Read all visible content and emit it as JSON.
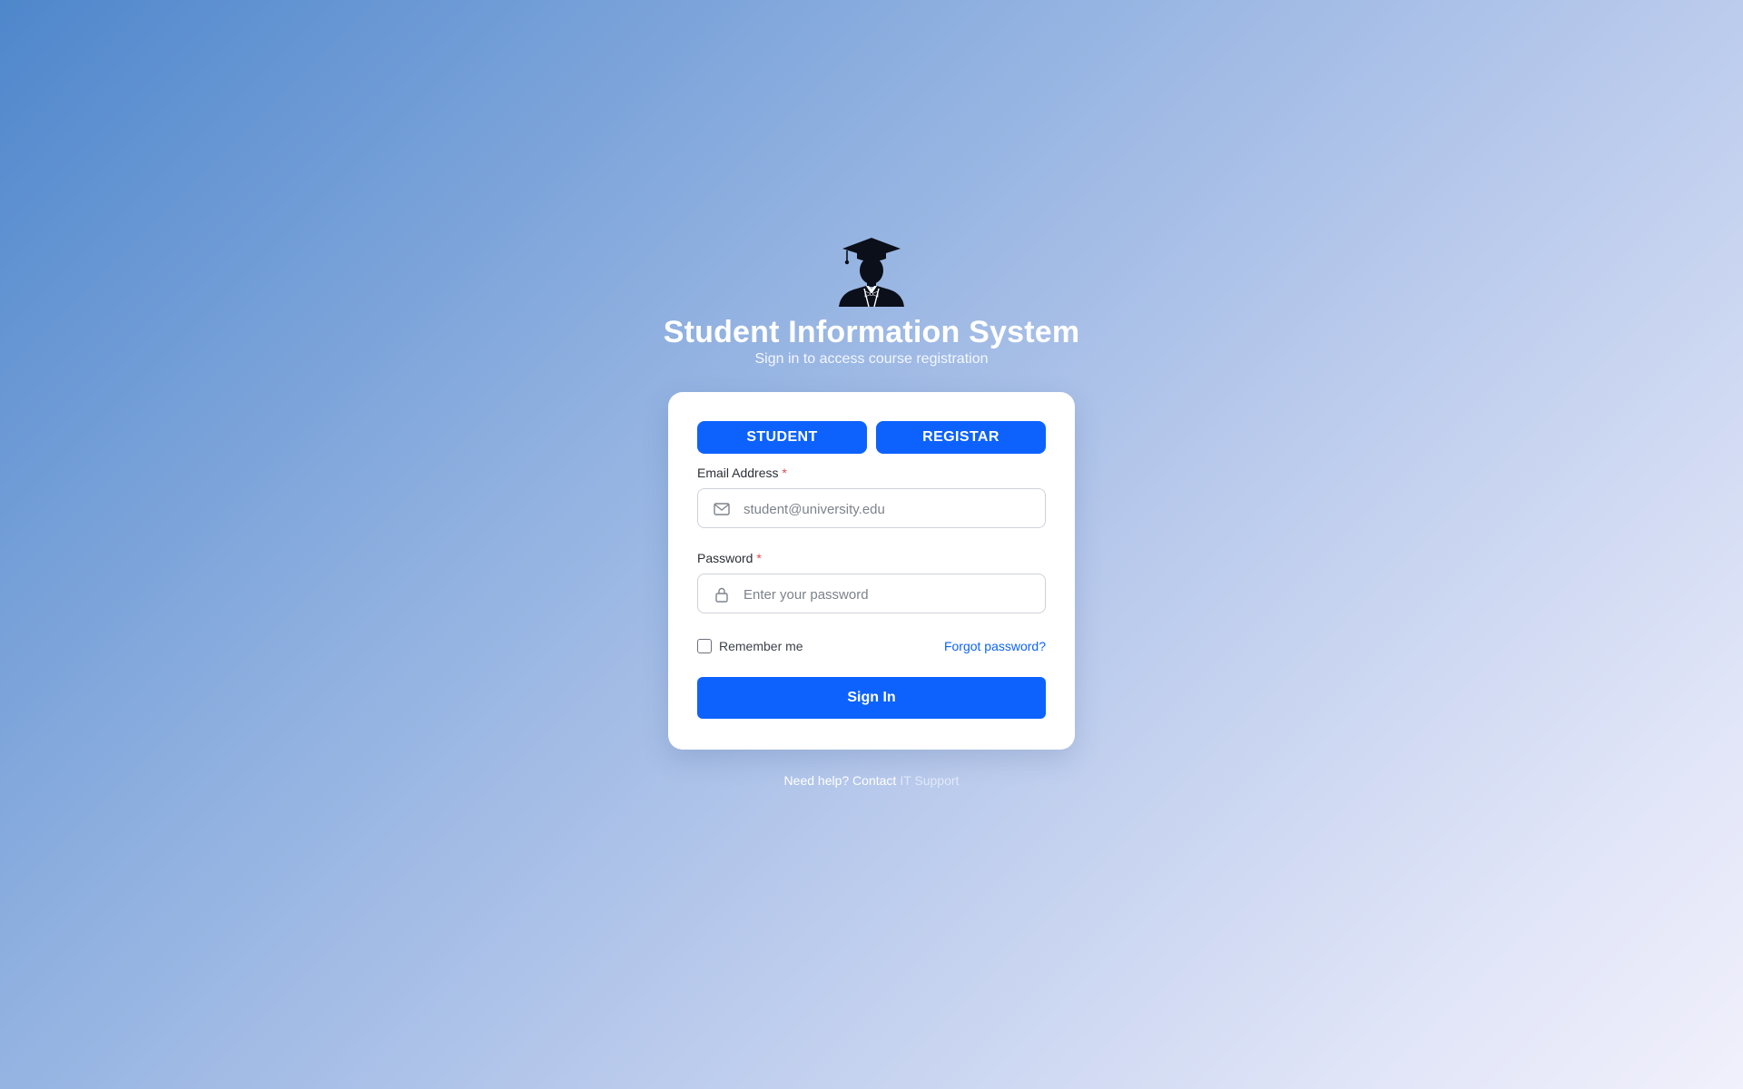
{
  "header": {
    "logo_icon": "graduate-student-icon",
    "title": "Student Information System",
    "subtitle": "Sign in to access course registration"
  },
  "roles": {
    "student_label": "STUDENT",
    "registrar_label": "REGISTAR"
  },
  "form": {
    "email_label": "Email Address",
    "email_required_mark": "*",
    "email_icon": "mail-icon",
    "email_placeholder": "student@university.edu",
    "password_label": "Password",
    "password_required_mark": "*",
    "password_icon": "lock-icon",
    "password_placeholder": "Enter your password",
    "remember_label": "Remember me",
    "remember_checked": false,
    "forgot_label": "Forgot password?",
    "submit_label": "Sign In"
  },
  "footer": {
    "help_text": "Need help? Contact",
    "support_link": "IT Support"
  },
  "colors": {
    "accent": "#0d62fd",
    "required": "#e5484d",
    "gradient_start": "#4f87cc",
    "gradient_end": "#f1f0fc"
  }
}
